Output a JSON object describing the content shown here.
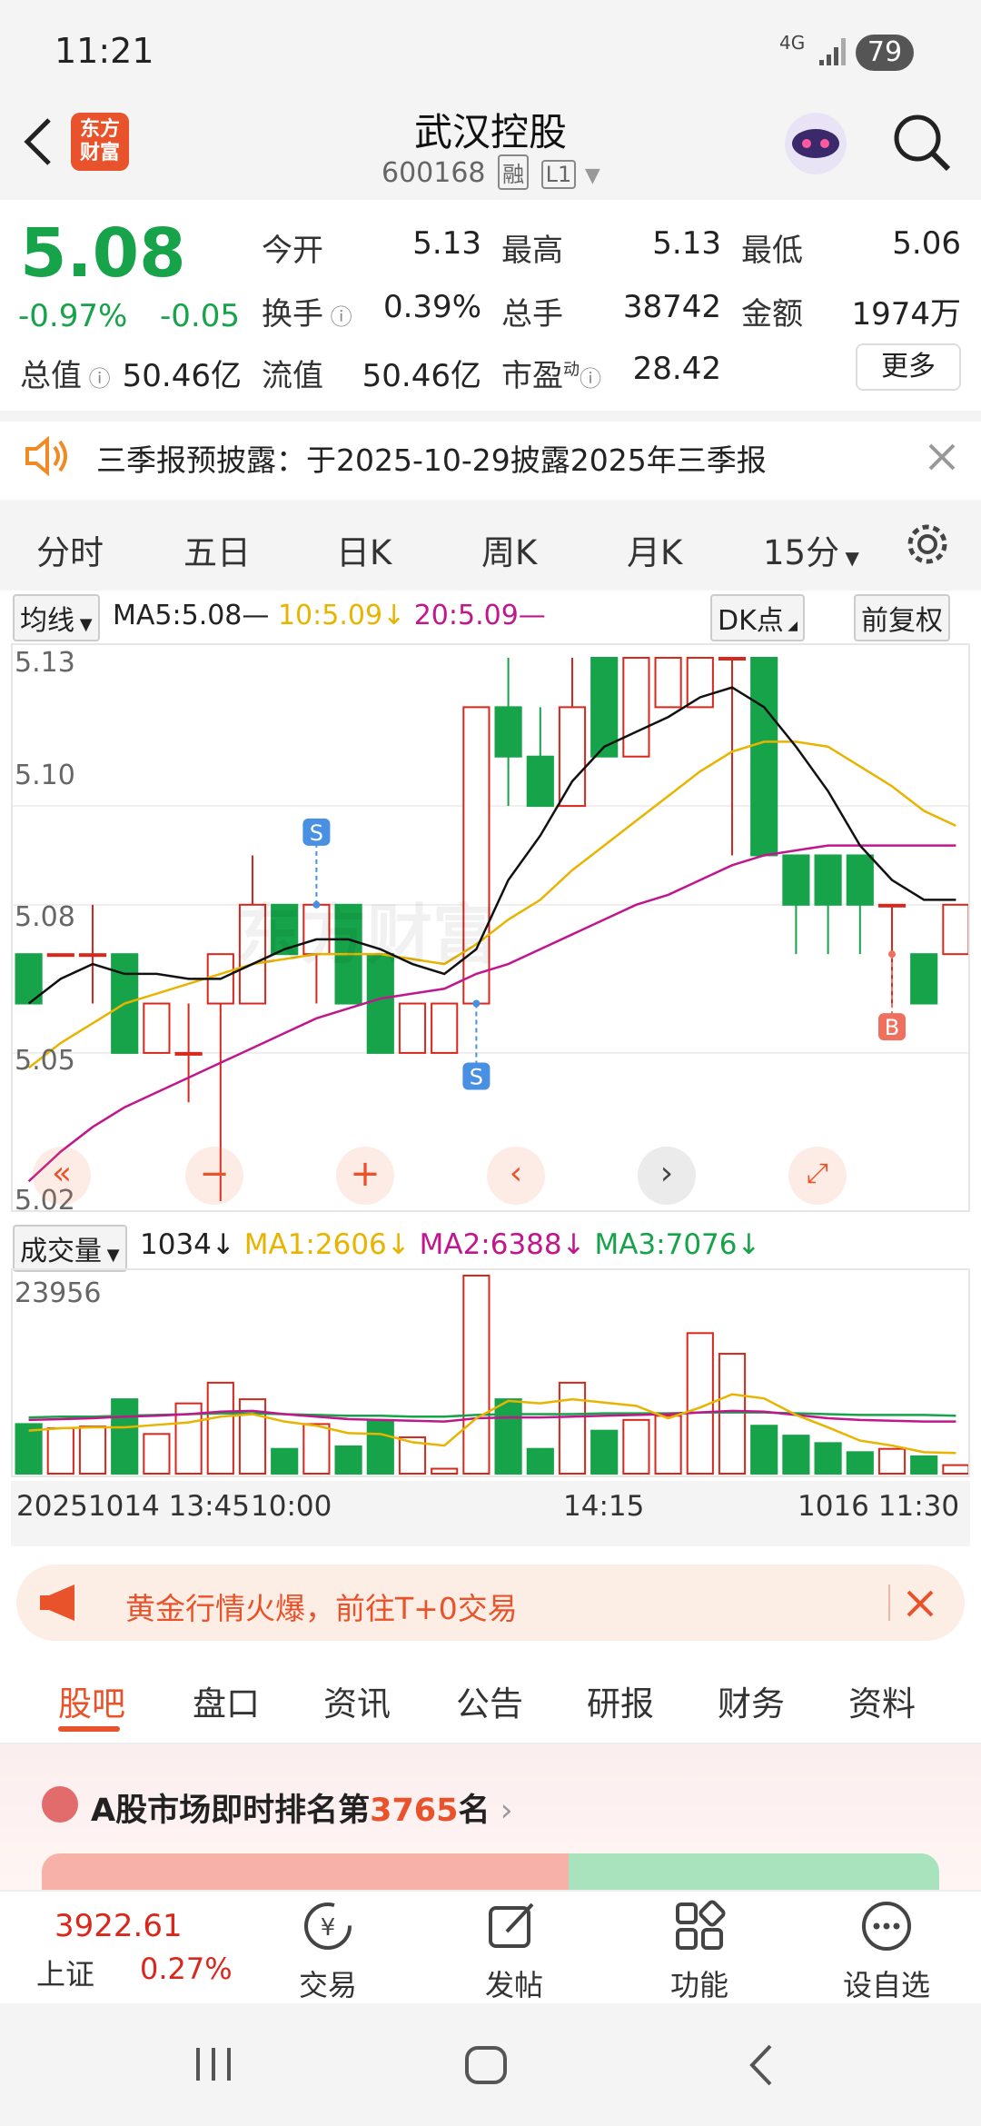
{
  "status_bar": {
    "time": "11:21",
    "network": "4G",
    "battery": "79"
  },
  "header": {
    "title": "武汉控股",
    "code": "600168",
    "tag1": "融",
    "tag2": "L1",
    "logo_text": "东方财富"
  },
  "quote": {
    "price": "5.08",
    "change_pct": "-0.97%",
    "change": "-0.05",
    "open_label": "今开",
    "open": "5.13",
    "high_label": "最高",
    "high": "5.13",
    "low_label": "最低",
    "low": "5.06",
    "turnover_label": "换手",
    "turnover": "0.39%",
    "volume_label": "总手",
    "volume": "38742",
    "amount_label": "金额",
    "amount": "1974万",
    "mcap_label": "总值",
    "mcap": "50.46亿",
    "float_label": "流值",
    "float": "50.46亿",
    "pe_label": "市盈",
    "pe_sup": "动",
    "pe": "28.42",
    "more": "更多"
  },
  "notice": {
    "text": "三季报预披露：于2025-10-29披露2025年三季报"
  },
  "period_tabs": [
    "分时",
    "五日",
    "日K",
    "周K",
    "月K",
    "15分"
  ],
  "ma_row": {
    "selector": "均线",
    "ma5": "MA5:5.08",
    "ma10": "10:5.09",
    "ma20": "20:5.09",
    "dk": "DK点",
    "adjust": "前复权"
  },
  "price_axis": [
    "5.13",
    "5.10",
    "5.08",
    "5.05",
    "5.02"
  ],
  "chart_markers": {
    "sell": "S",
    "buy": "B"
  },
  "volume_row": {
    "selector": "成交量",
    "vol": "1034",
    "ma1": "MA1:2606",
    "ma2": "MA2:6388",
    "ma3": "MA3:7076",
    "max": "23956"
  },
  "time_axis": [
    "20251014 13:45",
    "10:00",
    "14:15",
    "1016 11:30"
  ],
  "promo": {
    "text": "黄金行情火爆，前往T+0交易"
  },
  "content_tabs": [
    "股吧",
    "盘口",
    "资讯",
    "公告",
    "研报",
    "财务",
    "资料"
  ],
  "ranking": {
    "prefix": "A股市场即时排名第",
    "rank": "3765",
    "suffix": "名"
  },
  "bottom_nav": {
    "index_value": "3922.61",
    "index_name": "上证",
    "index_change": "0.27%",
    "items": [
      "交易",
      "发帖",
      "功能",
      "设自选"
    ]
  },
  "colors": {
    "up": "#d9271c",
    "down": "#16a34a",
    "accent": "#f08a24",
    "ma5": "#111111",
    "ma10": "#e8b400",
    "ma20": "#c0178c"
  },
  "chart_data": {
    "type": "candlestick",
    "ylim": [
      5.02,
      5.13
    ],
    "candles": [
      {
        "o": 5.07,
        "c": 5.06,
        "h": 5.07,
        "l": 5.06
      },
      {
        "o": 5.07,
        "c": 5.07,
        "h": 5.07,
        "l": 5.07
      },
      {
        "o": 5.07,
        "c": 5.07,
        "h": 5.08,
        "l": 5.06
      },
      {
        "o": 5.07,
        "c": 5.05,
        "h": 5.07,
        "l": 5.05
      },
      {
        "o": 5.05,
        "c": 5.06,
        "h": 5.06,
        "l": 5.05
      },
      {
        "o": 5.05,
        "c": 5.05,
        "h": 5.06,
        "l": 5.04
      },
      {
        "o": 5.06,
        "c": 5.07,
        "h": 5.07,
        "l": 5.02
      },
      {
        "o": 5.06,
        "c": 5.08,
        "h": 5.09,
        "l": 5.06
      },
      {
        "o": 5.08,
        "c": 5.07,
        "h": 5.08,
        "l": 5.07
      },
      {
        "o": 5.07,
        "c": 5.08,
        "h": 5.08,
        "l": 5.06
      },
      {
        "o": 5.08,
        "c": 5.06,
        "h": 5.08,
        "l": 5.06
      },
      {
        "o": 5.07,
        "c": 5.05,
        "h": 5.07,
        "l": 5.05
      },
      {
        "o": 5.05,
        "c": 5.06,
        "h": 5.06,
        "l": 5.05
      },
      {
        "o": 5.05,
        "c": 5.06,
        "h": 5.06,
        "l": 5.05
      },
      {
        "o": 5.06,
        "c": 5.12,
        "h": 5.12,
        "l": 5.06
      },
      {
        "o": 5.12,
        "c": 5.11,
        "h": 5.13,
        "l": 5.1
      },
      {
        "o": 5.11,
        "c": 5.1,
        "h": 5.12,
        "l": 5.1
      },
      {
        "o": 5.1,
        "c": 5.12,
        "h": 5.13,
        "l": 5.1
      },
      {
        "o": 5.13,
        "c": 5.11,
        "h": 5.13,
        "l": 5.11
      },
      {
        "o": 5.11,
        "c": 5.13,
        "h": 5.13,
        "l": 5.11
      },
      {
        "o": 5.12,
        "c": 5.13,
        "h": 5.13,
        "l": 5.12
      },
      {
        "o": 5.12,
        "c": 5.13,
        "h": 5.13,
        "l": 5.12
      },
      {
        "o": 5.13,
        "c": 5.13,
        "h": 5.13,
        "l": 5.09
      },
      {
        "o": 5.13,
        "c": 5.09,
        "h": 5.13,
        "l": 5.09
      },
      {
        "o": 5.09,
        "c": 5.08,
        "h": 5.09,
        "l": 5.07
      },
      {
        "o": 5.09,
        "c": 5.08,
        "h": 5.09,
        "l": 5.07
      },
      {
        "o": 5.09,
        "c": 5.08,
        "h": 5.09,
        "l": 5.07
      },
      {
        "o": 5.08,
        "c": 5.08,
        "h": 5.08,
        "l": 5.06
      },
      {
        "o": 5.07,
        "c": 5.06,
        "h": 5.07,
        "l": 5.06
      },
      {
        "o": 5.07,
        "c": 5.08,
        "h": 5.08,
        "l": 5.07
      }
    ],
    "ma5": [
      5.06,
      5.065,
      5.068,
      5.066,
      5.066,
      5.065,
      5.065,
      5.068,
      5.071,
      5.073,
      5.073,
      5.071,
      5.068,
      5.066,
      5.071,
      5.085,
      5.094,
      5.105,
      5.112,
      5.115,
      5.118,
      5.122,
      5.124,
      5.12,
      5.112,
      5.103,
      5.092,
      5.085,
      5.081,
      5.081
    ],
    "ma10": [
      5.047,
      5.052,
      5.056,
      5.06,
      5.062,
      5.064,
      5.066,
      5.068,
      5.069,
      5.07,
      5.07,
      5.07,
      5.069,
      5.068,
      5.072,
      5.077,
      5.081,
      5.087,
      5.092,
      5.097,
      5.102,
      5.107,
      5.111,
      5.113,
      5.113,
      5.112,
      5.108,
      5.104,
      5.099,
      5.096
    ],
    "ma20": [
      5.024,
      5.03,
      5.035,
      5.039,
      5.042,
      5.045,
      5.048,
      5.051,
      5.054,
      5.057,
      5.059,
      5.061,
      5.062,
      5.063,
      5.066,
      5.068,
      5.071,
      5.074,
      5.077,
      5.08,
      5.082,
      5.085,
      5.088,
      5.09,
      5.091,
      5.092,
      5.092,
      5.092,
      5.092,
      5.092
    ],
    "volume_ylim": [
      0,
      23956
    ],
    "volume": [
      6000,
      5500,
      5700,
      9000,
      4800,
      8500,
      11000,
      9000,
      3000,
      6000,
      3300,
      6500,
      4400,
      600,
      23956,
      9000,
      3000,
      11000,
      5200,
      6500,
      7000,
      17000,
      14500,
      5800,
      4600,
      3700,
      2600,
      3000,
      2100,
      1034
    ],
    "vol_ma1": [
      5200,
      5500,
      5600,
      5600,
      5900,
      6200,
      6900,
      7200,
      6300,
      5800,
      4900,
      4800,
      3800,
      3400,
      6700,
      8800,
      8500,
      9000,
      8600,
      8200,
      6700,
      8000,
      9600,
      9100,
      7100,
      5600,
      4000,
      3400,
      2600,
      2500
    ],
    "vol_ma2": [
      6500,
      6600,
      6700,
      6900,
      7000,
      7200,
      7500,
      7600,
      7200,
      6900,
      6600,
      6500,
      6400,
      6300,
      6700,
      6800,
      6800,
      6900,
      7000,
      7100,
      7200,
      7400,
      7600,
      7500,
      7100,
      6700,
      6500,
      6400,
      6300,
      6300
    ],
    "vol_ma3": [
      6800,
      6900,
      6900,
      7000,
      7100,
      7200,
      7300,
      7300,
      7200,
      7100,
      7000,
      7000,
      6900,
      6900,
      7100,
      7200,
      7200,
      7200,
      7300,
      7300,
      7300,
      7400,
      7400,
      7400,
      7300,
      7200,
      7100,
      7100,
      7100,
      7000
    ]
  }
}
